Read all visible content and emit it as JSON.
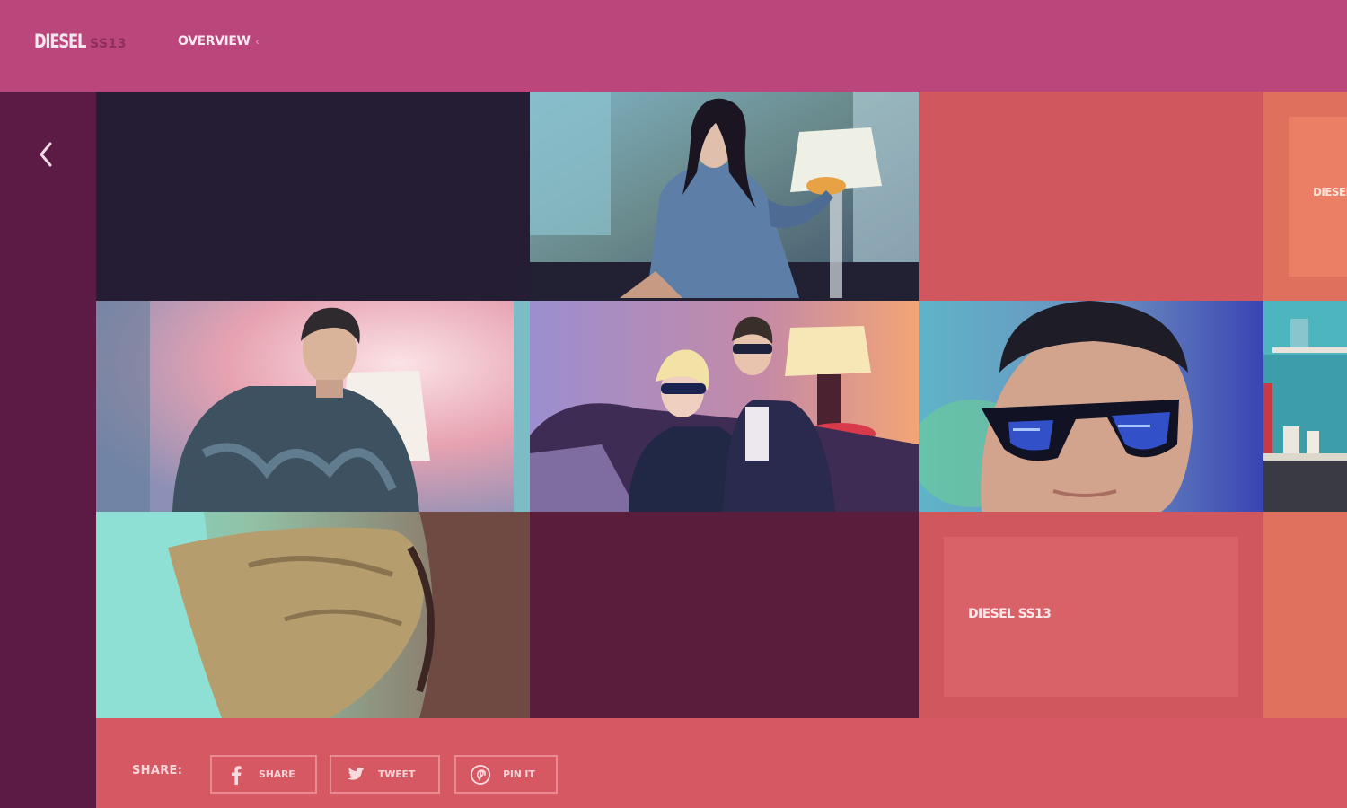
{
  "header": {
    "brand_name": "DIESEL",
    "brand_season": "SS13",
    "nav_overview": "OVERVIEW",
    "nav_chevron": "‹"
  },
  "sidebar": {
    "back_icon": "chevron-left-icon"
  },
  "tiles": {
    "top_right_label": "DIESEL",
    "feature_label": "DIESEL SS13"
  },
  "share": {
    "label": "SHARE:",
    "facebook_label": "SHARE",
    "twitter_label": "TWEET",
    "pinterest_label": "PIN IT",
    "icons": [
      "facebook-icon",
      "twitter-icon",
      "pinterest-icon"
    ]
  },
  "colors": {
    "header": "#bb467c",
    "rail": "#5c1b45",
    "dark_tile": "#241d33",
    "coral": "#d1575f",
    "orange": "#e0705e",
    "maroon": "#5a1d3c",
    "share_bar": "#d55863"
  }
}
